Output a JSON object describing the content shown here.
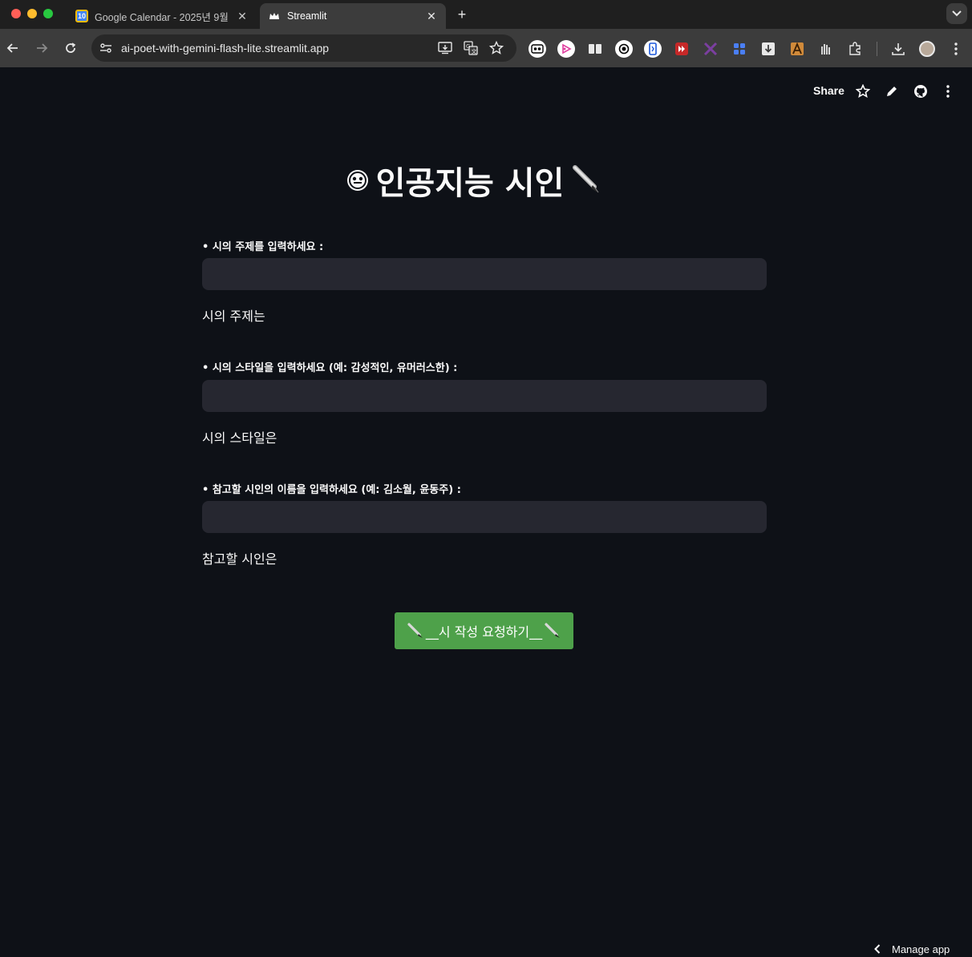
{
  "browser": {
    "tabs": [
      {
        "title": "Google Calendar - 2025년 9월",
        "favicon": "calendar-icon",
        "favicon_text": "10",
        "active": false
      },
      {
        "title": "Streamlit",
        "favicon": "streamlit-icon",
        "active": true
      }
    ],
    "url": "ai-poet-with-gemini-flash-lite.streamlit.app"
  },
  "app_header": {
    "share_label": "Share"
  },
  "main": {
    "title": "인공지능 시인",
    "fields": [
      {
        "label": "• 시의 주제를 입력하세요 :",
        "value": "",
        "echo": "시의 주제는"
      },
      {
        "label": "• 시의 스타일을 입력하세요 (예: 감성적인, 유머러스한) :",
        "value": "",
        "echo": "시의 스타일은"
      },
      {
        "label": "• 참고할 시인의 이름을 입력하세요 (예: 김소월, 윤동주) :",
        "value": "",
        "echo": "참고할 시인은"
      }
    ],
    "submit_label": "__시 작성 요청하기__"
  },
  "footer": {
    "manage_label": "Manage app"
  },
  "colors": {
    "background": "#0e1117",
    "input_bg": "#262730",
    "button": "#4ea14a",
    "text": "#fafafa"
  }
}
